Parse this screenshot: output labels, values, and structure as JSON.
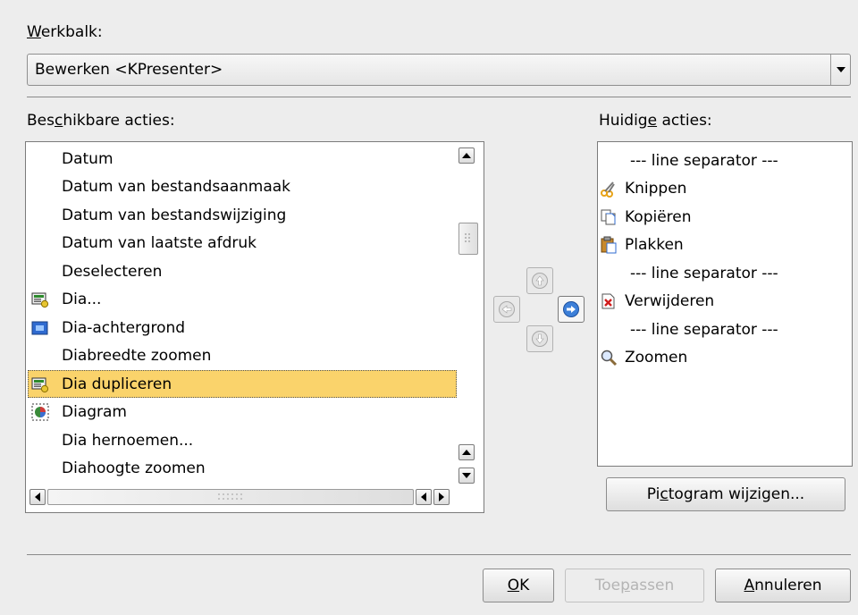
{
  "toolbar_label": {
    "pre": "",
    "key": "W",
    "post": "erkbalk:"
  },
  "toolbar_combo": {
    "value": "Bewerken <KPresenter>"
  },
  "available": {
    "label": {
      "pre": "Bes",
      "key": "c",
      "post": "hikbare acties:"
    },
    "items": [
      {
        "text": "Datum"
      },
      {
        "text": "Datum van bestandsaanmaak"
      },
      {
        "text": "Datum van bestandswijziging"
      },
      {
        "text": "Datum van laatste afdruk"
      },
      {
        "text": "Deselecteren"
      },
      {
        "text": "Dia...",
        "icon": "slide-add-icon"
      },
      {
        "text": "Dia-achtergrond",
        "icon": "slide-background-icon"
      },
      {
        "text": "Diabreedte zoomen"
      },
      {
        "text": "Dia dupliceren",
        "icon": "slide-duplicate-icon",
        "selected": true
      },
      {
        "text": "Diagram",
        "icon": "diagram-icon"
      },
      {
        "text": "Dia hernoemen..."
      },
      {
        "text": "Diahoogte zoomen"
      }
    ]
  },
  "current": {
    "label": {
      "pre": "Huidig",
      "key": "e",
      "post": " acties:"
    },
    "items": [
      {
        "text": "--- line separator ---"
      },
      {
        "text": "Knippen",
        "icon": "scissors-icon"
      },
      {
        "text": "Kopiëren",
        "icon": "copy-icon"
      },
      {
        "text": "Plakken",
        "icon": "paste-icon"
      },
      {
        "text": "--- line separator ---"
      },
      {
        "text": "Verwijderen",
        "icon": "delete-icon"
      },
      {
        "text": "--- line separator ---"
      },
      {
        "text": "Zoomen",
        "icon": "zoom-icon"
      }
    ]
  },
  "change_icon_button": {
    "pre": "Pi",
    "key": "c",
    "post": "togram wijzigen..."
  },
  "ok_button": {
    "pre": "",
    "key": "O",
    "post": "K"
  },
  "apply_button": {
    "pre": "Toe",
    "key": "p",
    "post": "assen"
  },
  "cancel_button": {
    "pre": "",
    "key": "A",
    "post": "nnuleren"
  },
  "colors": {
    "selection": "#fad36b",
    "window_bg": "#ededed",
    "arrow_active": "#3c7fd8"
  }
}
